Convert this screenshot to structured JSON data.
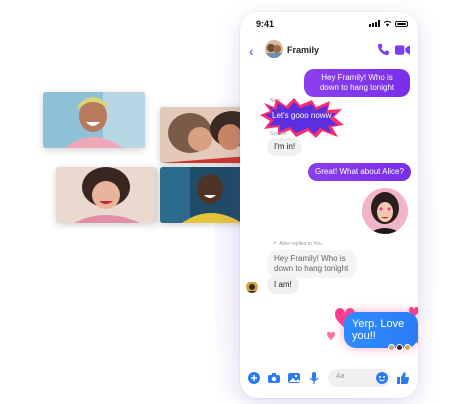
{
  "status": {
    "time": "9:41"
  },
  "header": {
    "title": "Framily",
    "back_icon": "back-chevron-icon",
    "call_icon": "phone-icon",
    "video_icon": "video-camera-icon"
  },
  "messages": {
    "m1": "Hey Framily! Who is down to hang tonight",
    "ning_name": "Ning",
    "m2": "Let's gooo noww",
    "gordon_name": "Gordon",
    "m3": "I'm in!",
    "m4": "Great! What about Alice?",
    "reply_label": "Alice replied to You",
    "m5": "Hey Framily! Who is down to hang tonight",
    "m6": "I am!",
    "m7": "Yerp. Love you!!"
  },
  "composer": {
    "placeholder": "Aa"
  },
  "colors": {
    "accent": "#7b3ff2",
    "love_bubble": "#2a7bf5",
    "heart": "#ff3d8a",
    "burst": "#ff2d6d"
  },
  "icons": [
    "plus-icon",
    "camera-icon",
    "image-icon",
    "microphone-icon",
    "emoji-icon",
    "thumbs-up-icon"
  ]
}
